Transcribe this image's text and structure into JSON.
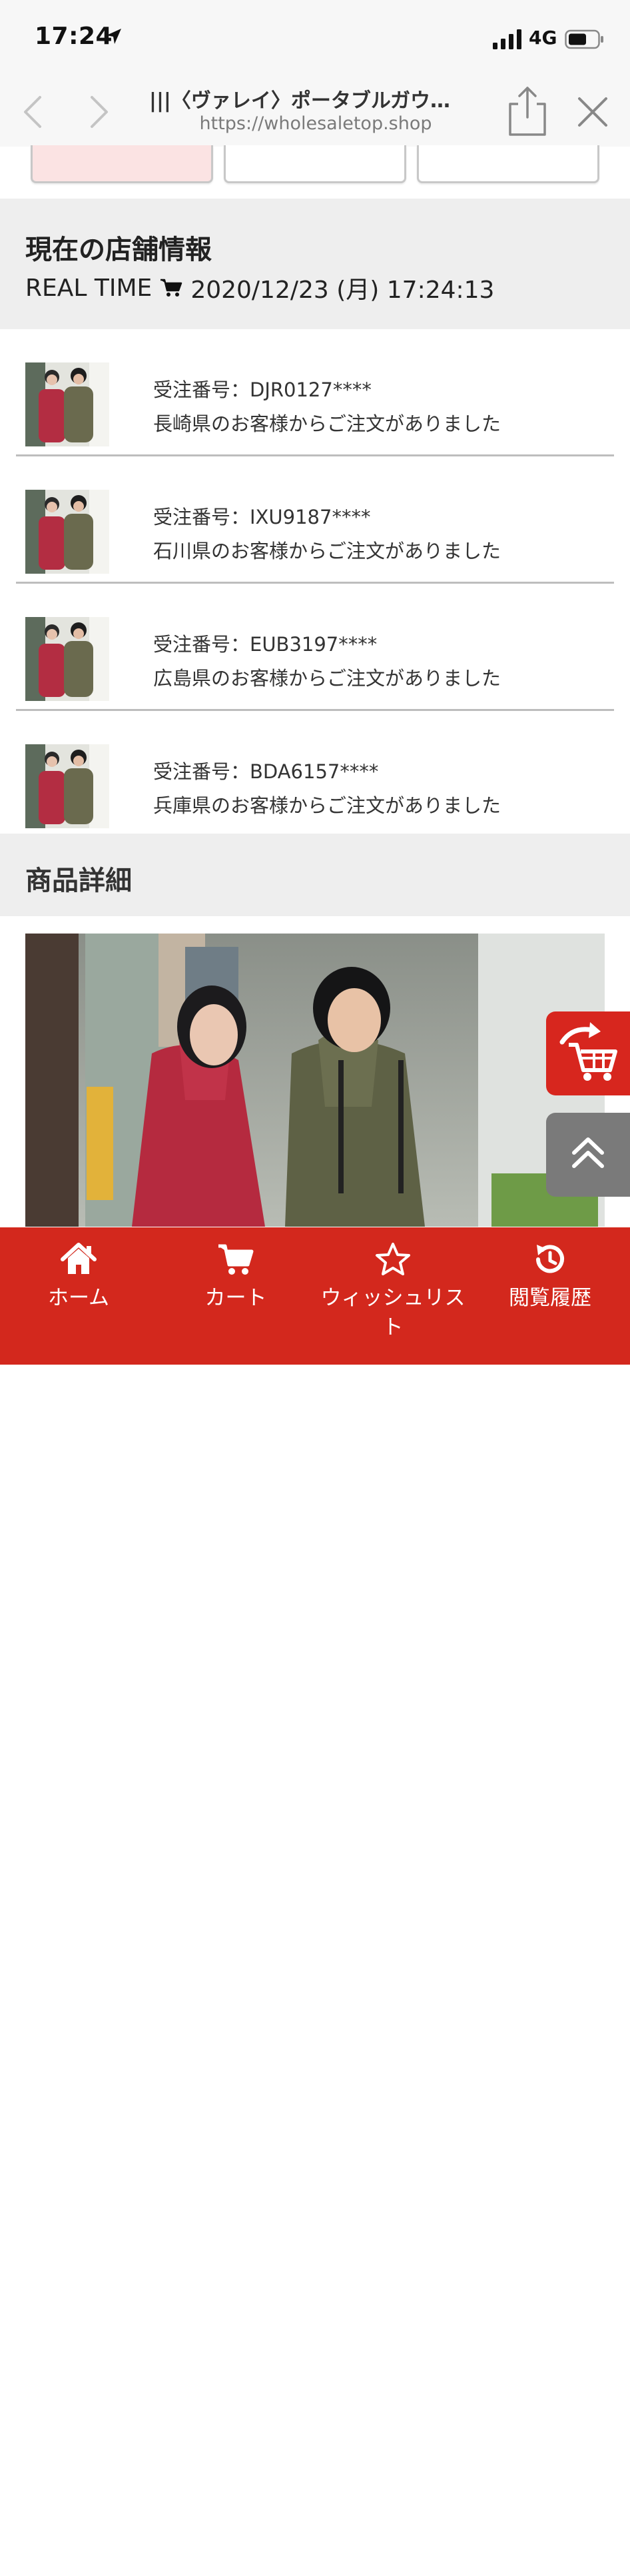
{
  "status_bar": {
    "time": "17:24",
    "network": "4G"
  },
  "browser": {
    "title": "|||〈ヴァレイ〉ポータブルガウ…",
    "url": "https://wholesaletop.shop"
  },
  "store_info": {
    "title": "現在の店舗情報",
    "realtime_label": "REAL TIME",
    "datetime": "2020/12/23 (月) 17:24:13"
  },
  "orders": [
    {
      "order_no": "受注番号：DJR0127****",
      "message": "長崎県のお客様からご注文がありました"
    },
    {
      "order_no": "受注番号：IXU9187****",
      "message": "石川県のお客様からご注文がありました"
    },
    {
      "order_no": "受注番号：EUB3197****",
      "message": "広島県のお客様からご注文がありました"
    },
    {
      "order_no": "受注番号：BDA6157****",
      "message": "兵庫県のお客様からご注文がありました"
    }
  ],
  "product_detail": {
    "title": "商品詳細"
  },
  "bottom_nav": {
    "home": "ホーム",
    "cart": "カート",
    "wishlist": "ウィッシュリスト",
    "history": "閲覧履歴"
  },
  "colors": {
    "brand_red": "#d3281d",
    "section_gray": "#eeeeee",
    "scroll_top_gray": "#7a7a7a"
  }
}
